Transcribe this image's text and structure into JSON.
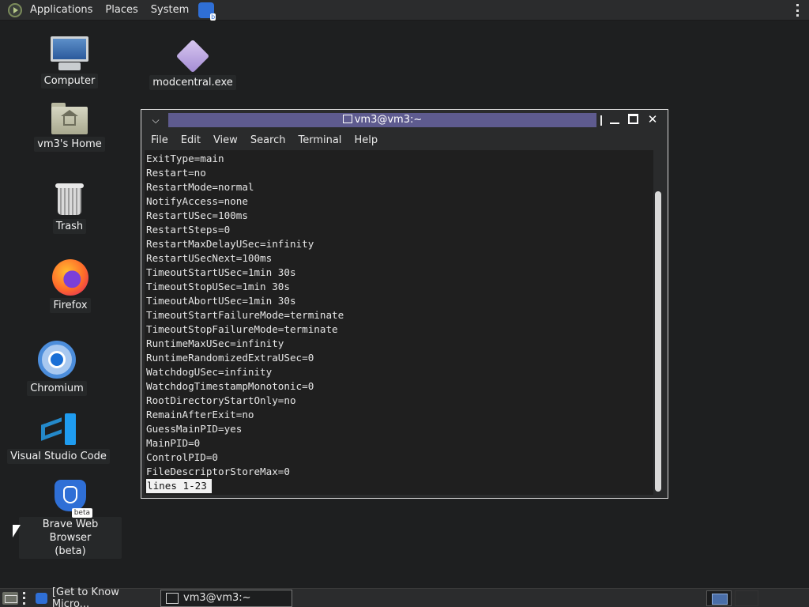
{
  "top_panel": {
    "menus": [
      "Applications",
      "Places",
      "System"
    ]
  },
  "desktop_icons": [
    {
      "label": "Computer",
      "icon": "computer-icon"
    },
    {
      "label": "modcentral.exe",
      "icon": "executable-icon"
    },
    {
      "label": "vm3's Home",
      "icon": "home-folder-icon"
    },
    {
      "label": "Trash",
      "icon": "trash-icon"
    },
    {
      "label": "Firefox",
      "icon": "firefox-icon"
    },
    {
      "label": "Chromium",
      "icon": "chromium-icon"
    },
    {
      "label": "Visual Studio Code",
      "icon": "vscode-icon"
    },
    {
      "label": "Brave Web Browser (beta)",
      "label_line1": "Brave Web Browser",
      "label_line2": "(beta)",
      "icon": "brave-icon",
      "badge": "beta"
    }
  ],
  "terminal": {
    "title": "vm3@vm3:~",
    "menu": [
      "File",
      "Edit",
      "View",
      "Search",
      "Terminal",
      "Help"
    ],
    "lines": [
      "ExitType=main",
      "Restart=no",
      "RestartMode=normal",
      "NotifyAccess=none",
      "RestartUSec=100ms",
      "RestartSteps=0",
      "RestartMaxDelayUSec=infinity",
      "RestartUSecNext=100ms",
      "TimeoutStartUSec=1min 30s",
      "TimeoutStopUSec=1min 30s",
      "TimeoutAbortUSec=1min 30s",
      "TimeoutStartFailureMode=terminate",
      "TimeoutStopFailureMode=terminate",
      "RuntimeMaxUSec=infinity",
      "RuntimeRandomizedExtraUSec=0",
      "WatchdogUSec=infinity",
      "WatchdogTimestampMonotonic=0",
      "RootDirectoryStartOnly=no",
      "RemainAfterExit=no",
      "GuessMainPID=yes",
      "MainPID=0",
      "ControlPID=0",
      "FileDescriptorStoreMax=0"
    ],
    "status": "lines 1-23"
  },
  "taskbar": {
    "tasks": [
      {
        "label": "[Get to Know Micro...",
        "icon": "brave-icon",
        "active": false
      },
      {
        "label": "vm3@vm3:~",
        "icon": "terminal-icon",
        "active": true
      }
    ]
  },
  "colors": {
    "desktop_bg": "#1e1f20",
    "title_active": "#5e5b8f",
    "terminal_bg": "#1f1f1f"
  }
}
